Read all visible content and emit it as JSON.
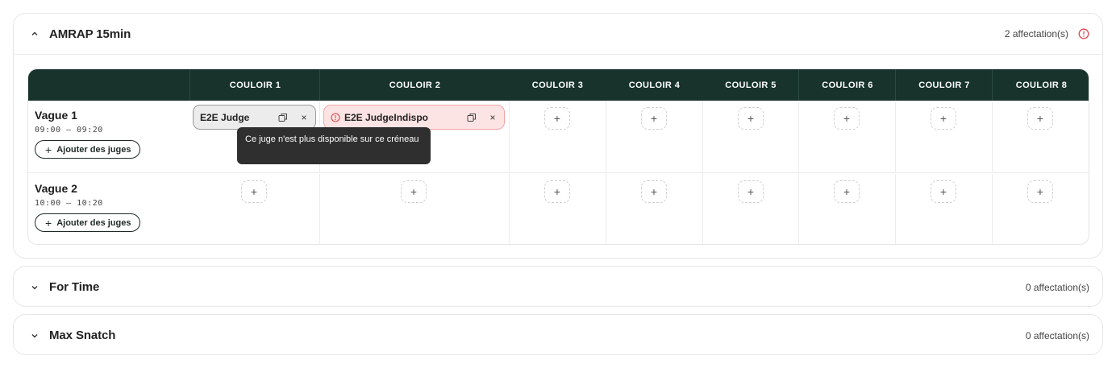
{
  "sections": [
    {
      "title": "AMRAP 15min",
      "count": "2 affectation(s)",
      "expanded": true,
      "has_warning": true
    },
    {
      "title": "For Time",
      "count": "0 affectation(s)",
      "expanded": false
    },
    {
      "title": "Max Snatch",
      "count": "0 affectation(s)",
      "expanded": false
    }
  ],
  "columns": [
    "COULOIR 1",
    "COULOIR 2",
    "COULOIR 3",
    "COULOIR 4",
    "COULOIR 5",
    "COULOIR 6",
    "COULOIR 7",
    "COULOIR 8"
  ],
  "rows": [
    {
      "name": "Vague 1",
      "time": "09:00 – 09:20",
      "add_label": "Ajouter des juges"
    },
    {
      "name": "Vague 2",
      "time": "10:00 – 10:20",
      "add_label": "Ajouter des juges"
    }
  ],
  "assignments": [
    {
      "judge": "E2E Judge",
      "lane": "COULOIR 1",
      "wave": "Vague 1",
      "status": "ok"
    },
    {
      "judge": "E2E JudgeIndispo",
      "lane": "COULOIR 2",
      "wave": "Vague 1",
      "status": "unavailable"
    }
  ],
  "tooltip": "Ce juge n'est plus disponible sur ce créneau",
  "plus_symbol": "+",
  "remove_symbol": "×",
  "colors": {
    "header_bg": "#17332b",
    "warning": "#e0444a",
    "chip_error_bg": "#fde4e4",
    "chip_ok_bg": "#ececec"
  }
}
